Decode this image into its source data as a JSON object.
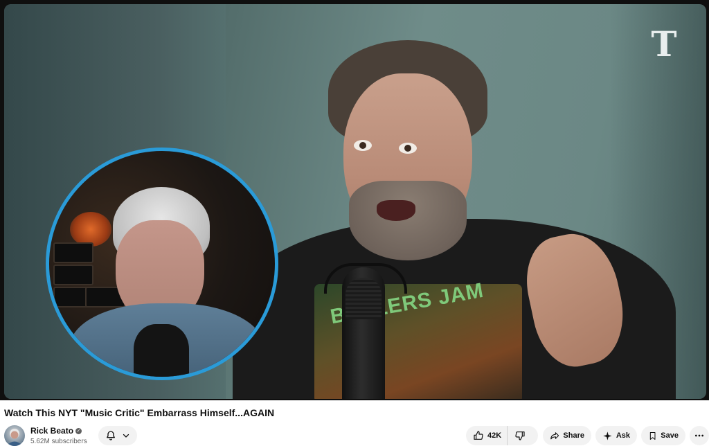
{
  "video": {
    "title": "Watch This NYT \"Music Critic\" Embarrass Himself...AGAIN",
    "watermark_logo": "T",
    "shirt_print_text": "BALLERS JAM"
  },
  "channel": {
    "name": "Rick Beato",
    "subscribers": "5.62M subscribers",
    "verified_icon": "check-circle-icon"
  },
  "actions": {
    "subscribe_bell_icon": "bell-icon",
    "like_count": "42K",
    "share_label": "Share",
    "ask_label": "Ask",
    "save_label": "Save"
  },
  "colors": {
    "pip_border": "#2a9bd8",
    "pill_background": "#f2f2f2"
  }
}
